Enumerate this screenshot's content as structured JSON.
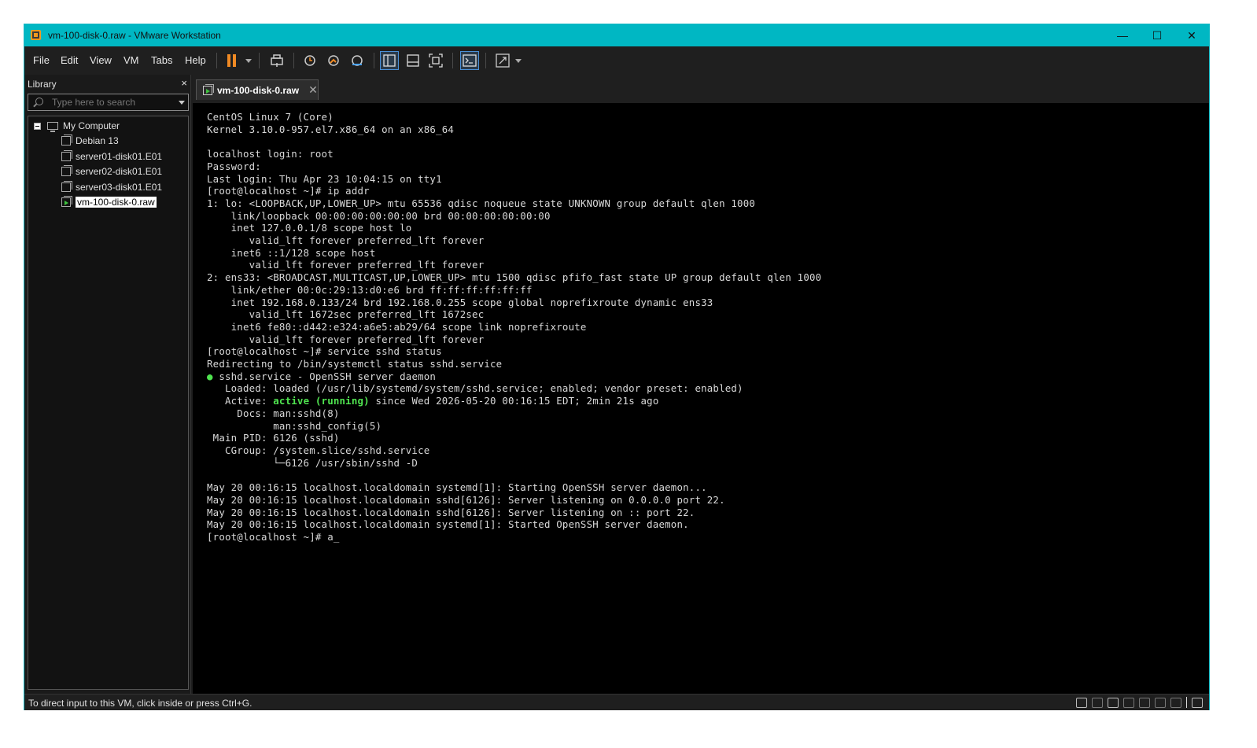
{
  "window": {
    "title": "vm-100-disk-0.raw - VMware Workstation",
    "accent": "#00b7c3",
    "controls": {
      "minimize": "—",
      "maximize": "☐",
      "close": "✕"
    }
  },
  "menu": [
    "File",
    "Edit",
    "View",
    "VM",
    "Tabs",
    "Help"
  ],
  "toolbar": {
    "icons": [
      "pause-icon",
      "send-ctrl-alt-del-icon",
      "snapshot-icon",
      "revert-snapshot-icon",
      "snapshot-manager-icon",
      "show-library-icon",
      "show-thumbnail-icon",
      "full-screen-icon",
      "console-view-icon",
      "stretch-icon"
    ]
  },
  "library": {
    "title": "Library",
    "close": "×",
    "search_placeholder": "Type here to search",
    "root": "My Computer",
    "items": [
      "Debian 13",
      "server01-disk01.E01",
      "server02-disk01.E01",
      "server03-disk01.E01",
      "vm-100-disk-0.raw"
    ],
    "selected": "vm-100-disk-0.raw"
  },
  "tab": {
    "label": "vm-100-disk-0.raw",
    "close": "✕"
  },
  "console": {
    "before_status": "CentOS Linux 7 (Core)\nKernel 3.10.0-957.el7.x86_64 on an x86_64\n\nlocalhost login: root\nPassword:\nLast login: Thu Apr 23 10:04:15 on tty1\n[root@localhost ~]# ip addr\n1: lo: <LOOPBACK,UP,LOWER_UP> mtu 65536 qdisc noqueue state UNKNOWN group default qlen 1000\n    link/loopback 00:00:00:00:00:00 brd 00:00:00:00:00:00\n    inet 127.0.0.1/8 scope host lo\n       valid_lft forever preferred_lft forever\n    inet6 ::1/128 scope host\n       valid_lft forever preferred_lft forever\n2: ens33: <BROADCAST,MULTICAST,UP,LOWER_UP> mtu 1500 qdisc pfifo_fast state UP group default qlen 1000\n    link/ether 00:0c:29:13:d0:e6 brd ff:ff:ff:ff:ff:ff\n    inet 192.168.0.133/24 brd 192.168.0.255 scope global noprefixroute dynamic ens33\n       valid_lft 1672sec preferred_lft 1672sec\n    inet6 fe80::d442:e324:a6e5:ab29/64 scope link noprefixroute\n       valid_lft forever preferred_lft forever\n[root@localhost ~]# service sshd status\nRedirecting to /bin/systemctl status sshd.service\n",
    "bullet": "●",
    "service_line": " sshd.service - OpenSSH server daemon\n   Loaded: loaded (/usr/lib/systemd/system/sshd.service; enabled; vendor preset: enabled)\n   Active: ",
    "active_status": "active (running)",
    "after_status": " since Wed 2026-05-20 00:16:15 EDT; 2min 21s ago\n     Docs: man:sshd(8)\n           man:sshd_config(5)\n Main PID: 6126 (sshd)\n   CGroup: /system.slice/sshd.service\n           └─6126 /usr/sbin/sshd -D\n\nMay 20 00:16:15 localhost.localdomain systemd[1]: Starting OpenSSH server daemon...\nMay 20 00:16:15 localhost.localdomain sshd[6126]: Server listening on 0.0.0.0 port 22.\nMay 20 00:16:15 localhost.localdomain sshd[6126]: Server listening on :: port 22.\nMay 20 00:16:15 localhost.localdomain systemd[1]: Started OpenSSH server daemon.\n[root@localhost ~]# a_"
  },
  "status": {
    "message": "To direct input to this VM, click inside or press Ctrl+G.",
    "devices": [
      "hard-disk-icon",
      "cd-dvd-icon",
      "network-icon",
      "usb-icon",
      "sound-icon",
      "printer-icon",
      "display-icon",
      "message-icon"
    ]
  }
}
